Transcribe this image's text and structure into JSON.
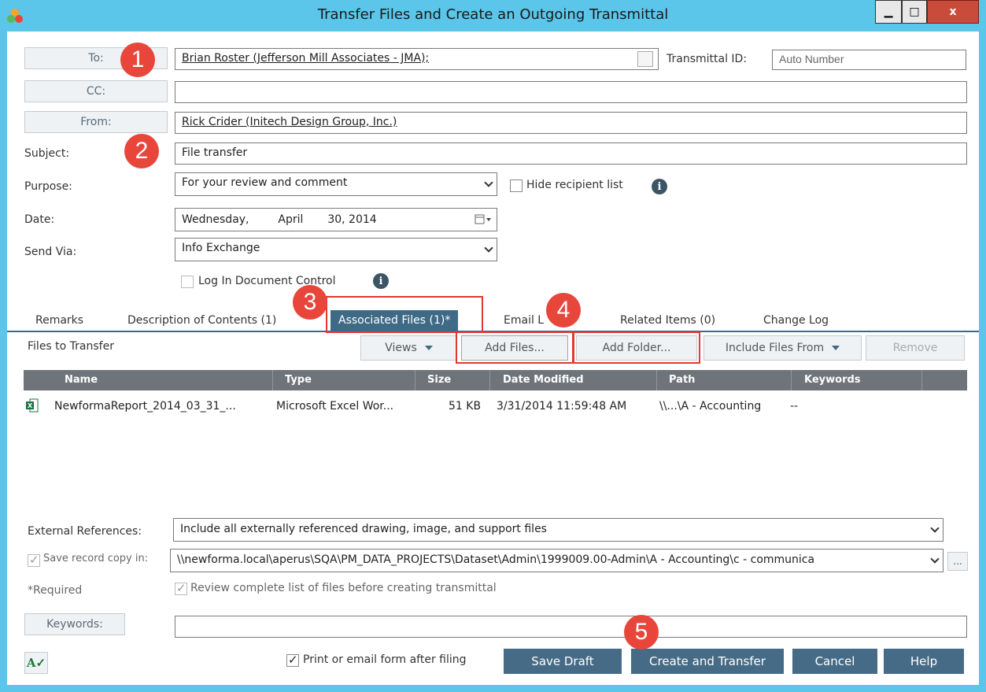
{
  "window": {
    "title": "Transfer Files and Create an Outgoing Transmittal",
    "min_label": "▁",
    "max_label": "□",
    "close_label": "x"
  },
  "form": {
    "to_label": "To:",
    "to_value": "Brian Roster (Jefferson Mill Associates - JMA);",
    "transmittal_id_label": "Transmittal ID:",
    "transmittal_id_placeholder": "Auto Number",
    "cc_label": "CC:",
    "cc_value": "",
    "from_label": "From:",
    "from_value": "Rick Crider (Initech Design Group, Inc.)",
    "subject_label": "Subject:",
    "subject_value": "File transfer",
    "purpose_label": "Purpose:",
    "purpose_value": "For your review and comment",
    "hide_recipient_label": "Hide recipient list",
    "date_label": "Date:",
    "date_weekday": "Wednesday,",
    "date_month": "April",
    "date_day_year": "30, 2014",
    "send_via_label": "Send Via:",
    "send_via_value": "Info Exchange",
    "log_doc_control_label": "Log In Document Control"
  },
  "badges": [
    "1",
    "2",
    "3",
    "4",
    "5"
  ],
  "tabs": [
    {
      "label": "Remarks"
    },
    {
      "label": "Description of Contents (1)"
    },
    {
      "label": "Associated Files (1)*"
    },
    {
      "label": "Email L"
    },
    {
      "label": "Related Items (0)"
    },
    {
      "label": "Change Log"
    }
  ],
  "toolbar": {
    "files_to_transfer": "Files to Transfer",
    "views": "Views",
    "add_files": "Add Files...",
    "add_folder": "Add Folder...",
    "include_files_from": "Include Files From",
    "remove": "Remove"
  },
  "grid": {
    "columns": [
      "Name",
      "Type",
      "Size",
      "Date Modified",
      "Path",
      "Keywords"
    ],
    "rows": [
      {
        "name": "NewformaReport_2014_03_31_...",
        "type": "Microsoft Excel Wor...",
        "size": "51 KB",
        "date_modified": "3/31/2014 11:59:48 AM",
        "path": "\\\\...\\A - Accounting",
        "keywords": "--"
      }
    ]
  },
  "bottom": {
    "external_refs_label": "External References:",
    "external_refs_value": "Include all externally referenced drawing, image, and support files",
    "save_record_label": "Save record copy in:",
    "save_record_value": "\\\\newforma.local\\aperus\\SQA\\PM_DATA_PROJECTS\\Dataset\\Admin\\1999009.00-Admin\\A - Accounting\\c - communica",
    "ellipsis": "...",
    "required_label": "*Required",
    "review_label": "Review complete list of files before creating transmittal",
    "keywords_label": "Keywords:",
    "keywords_value": "",
    "print_label": "Print or email form after filing",
    "save_draft": "Save Draft",
    "create_transfer": "Create and Transfer",
    "cancel": "Cancel",
    "help": "Help"
  },
  "colors": {
    "titlebar": "#5bc5ea",
    "accent": "#466b86",
    "badge": "#e8463a",
    "close": "#c94b3c"
  }
}
